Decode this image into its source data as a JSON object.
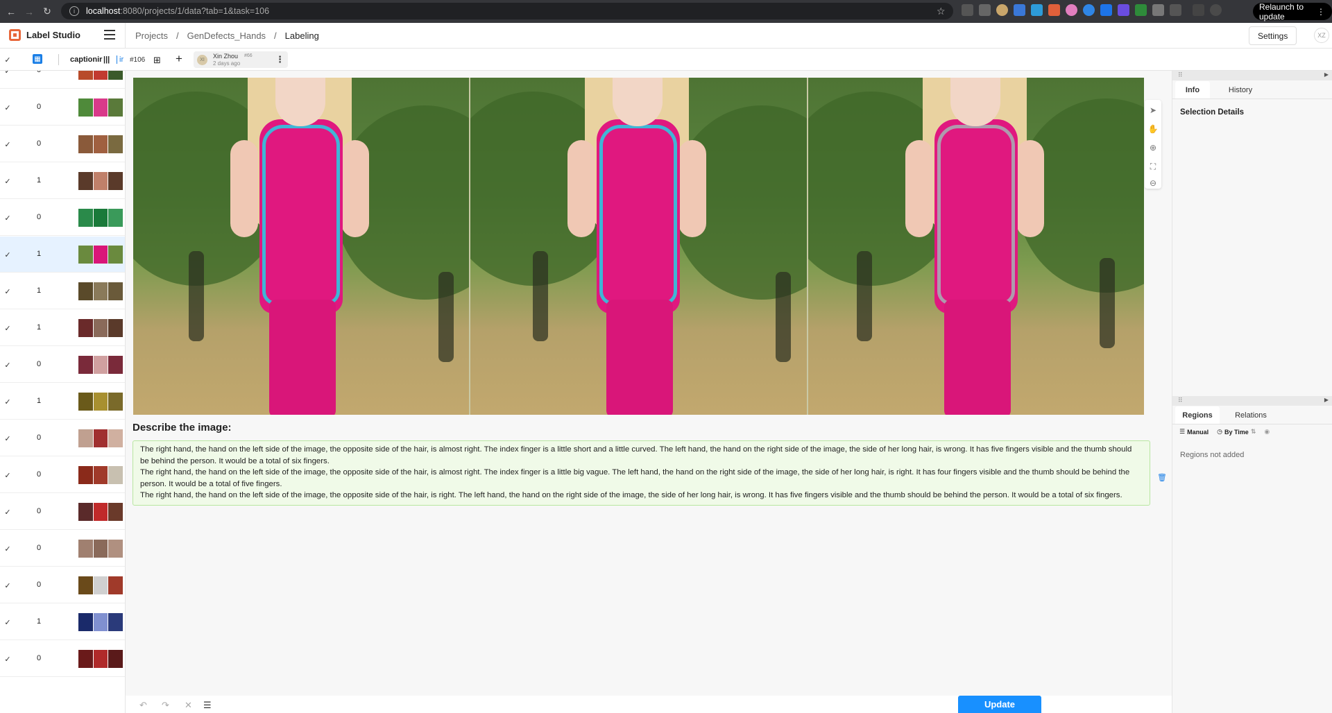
{
  "browser": {
    "url_host": "localhost",
    "url_path": ":8080/projects/1/data?tab=1&task=106",
    "relaunch_label": "Relaunch to update"
  },
  "app": {
    "name": "Label Studio",
    "breadcrumb": [
      "Projects",
      "GenDefects_Hands",
      "Labeling"
    ],
    "settings_label": "Settings",
    "user_initials": "XZ"
  },
  "toolbar": {
    "column_label": "captionir",
    "ir_label": "ir",
    "task_id": "#106",
    "annotator_name": "Xin Zhou",
    "annotator_number": "#66",
    "annotator_time": "2 days ago",
    "annotator_initials": "XI"
  },
  "tasks": [
    {
      "value": "0",
      "selected": false,
      "colors": [
        "#b84b2a",
        "#c23a30",
        "#3a5a2a"
      ]
    },
    {
      "value": "0",
      "selected": false,
      "colors": [
        "#4f8a3a",
        "#d93a8a",
        "#5a7a3a"
      ]
    },
    {
      "value": "0",
      "selected": false,
      "colors": [
        "#8a5a3a",
        "#a06040",
        "#7a6a40"
      ]
    },
    {
      "value": "1",
      "selected": false,
      "colors": [
        "#5a3a2a",
        "#c0806a",
        "#5a3a2a"
      ]
    },
    {
      "value": "0",
      "selected": false,
      "colors": [
        "#2a8a4a",
        "#1a7a3a",
        "#3a9a5a"
      ]
    },
    {
      "value": "1",
      "selected": true,
      "colors": [
        "#6a8a3e",
        "#d91679",
        "#6a8a3e"
      ]
    },
    {
      "value": "1",
      "selected": false,
      "colors": [
        "#5a4a2a",
        "#8a7a5a",
        "#6a5a3a"
      ]
    },
    {
      "value": "1",
      "selected": false,
      "colors": [
        "#6a2a2a",
        "#8a6a5a",
        "#5a3a2a"
      ]
    },
    {
      "value": "0",
      "selected": false,
      "colors": [
        "#7a2a3a",
        "#d0a0a0",
        "#7a2a3a"
      ]
    },
    {
      "value": "1",
      "selected": false,
      "colors": [
        "#6a5a1a",
        "#a89030",
        "#7a6a2a"
      ]
    },
    {
      "value": "0",
      "selected": false,
      "colors": [
        "#c0a090",
        "#a03030",
        "#d0b0a0"
      ]
    },
    {
      "value": "0",
      "selected": false,
      "colors": [
        "#8a2a1a",
        "#a03a2a",
        "#c8c0b0"
      ]
    },
    {
      "value": "0",
      "selected": false,
      "colors": [
        "#5a2a2a",
        "#c02a2a",
        "#6a3a2a"
      ]
    },
    {
      "value": "0",
      "selected": false,
      "colors": [
        "#a08070",
        "#8a6a5a",
        "#b09080"
      ]
    },
    {
      "value": "0",
      "selected": false,
      "colors": [
        "#6a4a1a",
        "#d0d0d0",
        "#a03a2a"
      ]
    },
    {
      "value": "1",
      "selected": false,
      "colors": [
        "#1a2a6a",
        "#8090d0",
        "#2a3a7a"
      ]
    },
    {
      "value": "0",
      "selected": false,
      "colors": [
        "#6a1a1a",
        "#b02a2a",
        "#5a1a1a"
      ]
    }
  ],
  "main": {
    "question": "Describe the image:",
    "answers": [
      "The right hand, the hand on the left side of the image, the opposite side of the hair, is almost right. The index finger is a little short and a little curved. The left hand, the hand on the right side of the image, the side of her long hair, is wrong. It has five fingers visible and the thumb should be behind the person. It would be a total of six fingers.",
      "The right hand, the hand on the left side of the image, the opposite side of the hair, is almost right. The index finger is a little big vague. The left hand, the hand on the right side of the image, the side of her long hair, is right. It has four fingers visible and the thumb should be behind the person. It would be a total of five fingers.",
      "The right hand, the hand on the left side of the image, the opposite side of the hair, is right. The left hand, the hand on the right side of the image, the side of her long hair, is wrong. It has five fingers visible and the thumb should be behind the person. It would be a total of six fingers."
    ],
    "update_label": "Update"
  },
  "sidebar": {
    "tabs_top": [
      "Info",
      "History"
    ],
    "selection_title": "Selection Details",
    "tabs_bottom": [
      "Regions",
      "Relations"
    ],
    "manual_label": "Manual",
    "by_time_label": "By Time",
    "empty_regions": "Regions not added"
  }
}
